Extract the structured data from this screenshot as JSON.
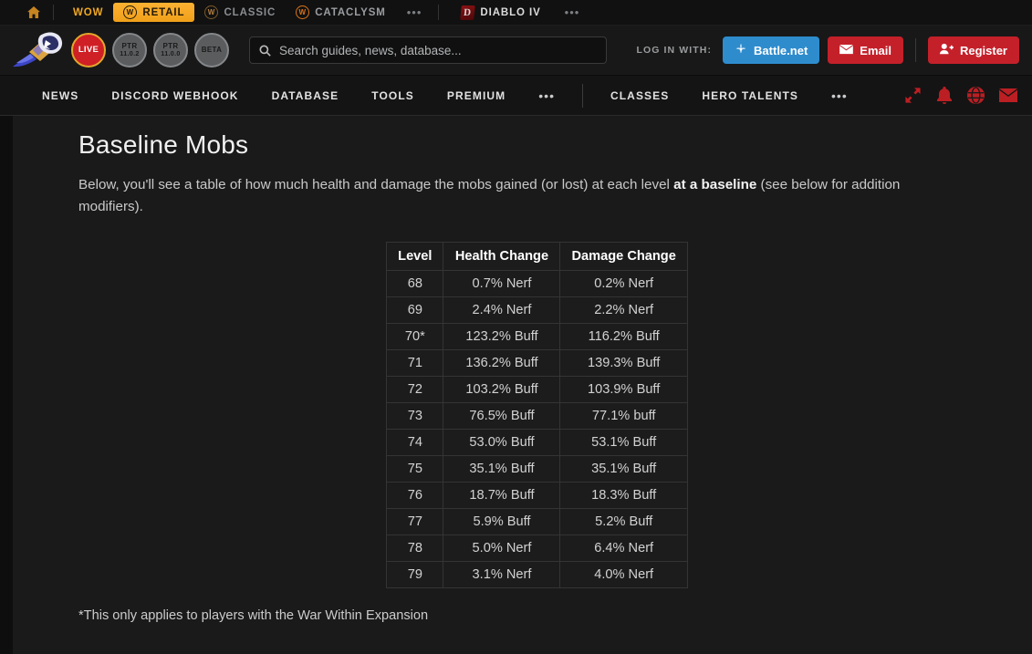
{
  "gamebar": {
    "home_icon": "home-icon",
    "items": [
      {
        "label": "WOW",
        "icon": null,
        "state": "brand"
      },
      {
        "label": "RETAIL",
        "icon": "wow-w-icon",
        "state": "active"
      },
      {
        "label": "CLASSIC",
        "icon": "wow-w-icon",
        "state": "muted"
      },
      {
        "label": "CATACLYSM",
        "icon": "wow-w-icon",
        "state": "cata"
      }
    ],
    "overflow": "•••",
    "diablo": {
      "label": "DIABLO IV",
      "icon": "diablo-icon",
      "glyph": "D"
    },
    "diablo_overflow": "•••"
  },
  "mainbar": {
    "logo_name": "wowhead-logo",
    "realms": [
      {
        "name": "LIVE",
        "version": "",
        "state": "live"
      },
      {
        "name": "PTR",
        "version": "11.0.2",
        "state": "normal"
      },
      {
        "name": "PTR",
        "version": "11.0.0",
        "state": "normal"
      },
      {
        "name": "BETA",
        "version": "",
        "state": "normal"
      }
    ],
    "search": {
      "value": "",
      "placeholder": "Search guides, news, database...",
      "icon": "search-icon"
    },
    "login_label": "LOG IN WITH:",
    "buttons": [
      {
        "label": "Battle.net",
        "icon": "battlenet-icon",
        "color": "#2e8ccd"
      },
      {
        "label": "Email",
        "icon": "envelope-icon",
        "color": "#c4202a"
      },
      {
        "label": "Register",
        "icon": "user-plus-icon",
        "color": "#c4202a"
      }
    ]
  },
  "nav": {
    "left_items": [
      "NEWS",
      "DISCORD WEBHOOK",
      "DATABASE",
      "TOOLS",
      "PREMIUM"
    ],
    "left_overflow": "•••",
    "right_items": [
      "CLASSES",
      "HERO TALENTS"
    ],
    "right_overflow": "•••",
    "icons": [
      "expand-icon",
      "bell-icon",
      "globe-icon",
      "envelope-icon"
    ],
    "icon_color": "#bb1f23"
  },
  "main": {
    "title": "Baseline Mobs",
    "intro_part1": "Below, you'll see a table of how much health and damage the mobs gained (or lost) at each level ",
    "intro_bold": "at a baseline",
    "intro_part2": " (see below for addition modifiers).",
    "footnote": "*This only applies to players with the War Within Expansion"
  },
  "chart_data": {
    "type": "table",
    "title": "Baseline Mobs",
    "columns": [
      "Level",
      "Health Change",
      "Damage Change"
    ],
    "rows": [
      [
        "68",
        "0.7% Nerf",
        "0.2% Nerf"
      ],
      [
        "69",
        "2.4% Nerf",
        "2.2% Nerf"
      ],
      [
        "70*",
        "123.2% Buff",
        "116.2% Buff"
      ],
      [
        "71",
        "136.2% Buff",
        "139.3% Buff"
      ],
      [
        "72",
        "103.2% Buff",
        "103.9% Buff"
      ],
      [
        "73",
        "76.5% Buff",
        "77.1% buff"
      ],
      [
        "74",
        "53.0% Buff",
        "53.1% Buff"
      ],
      [
        "75",
        "35.1% Buff",
        "35.1% Buff"
      ],
      [
        "76",
        "18.7% Buff",
        "18.3% Buff"
      ],
      [
        "77",
        "5.9% Buff",
        "5.2% Buff"
      ],
      [
        "78",
        "5.0% Nerf",
        "6.4% Nerf"
      ],
      [
        "79",
        "3.1% Nerf",
        "4.0% Nerf"
      ]
    ]
  }
}
